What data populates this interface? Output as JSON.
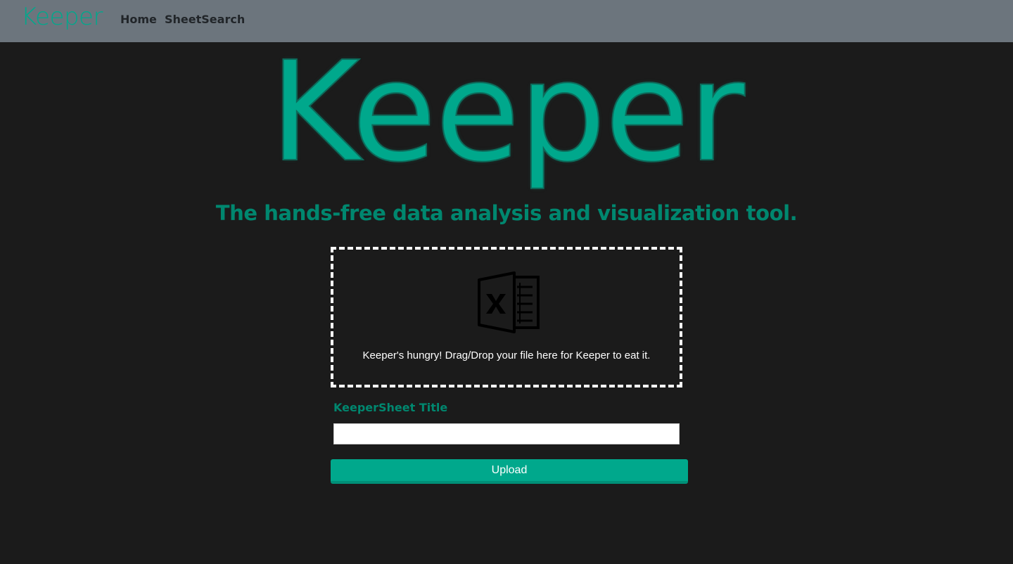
{
  "navbar": {
    "brand": "Keeper",
    "links": [
      {
        "label": "Home"
      },
      {
        "label": "SheetSearch"
      }
    ]
  },
  "hero": {
    "title": "Keeper",
    "tagline": "The hands-free data analysis and visualization tool."
  },
  "dropzone": {
    "icon": "excel-file-icon",
    "text": "Keeper's hungry! Drag/Drop your file here for Keeper to eat it."
  },
  "form": {
    "title_label": "KeeperSheet Title",
    "title_value": "",
    "title_placeholder": "",
    "upload_label": "Upload"
  },
  "colors": {
    "accent": "#00a88c",
    "accent_dark": "#00876f",
    "navbar_bg": "#6c757d",
    "page_bg": "#1b1b1b"
  }
}
